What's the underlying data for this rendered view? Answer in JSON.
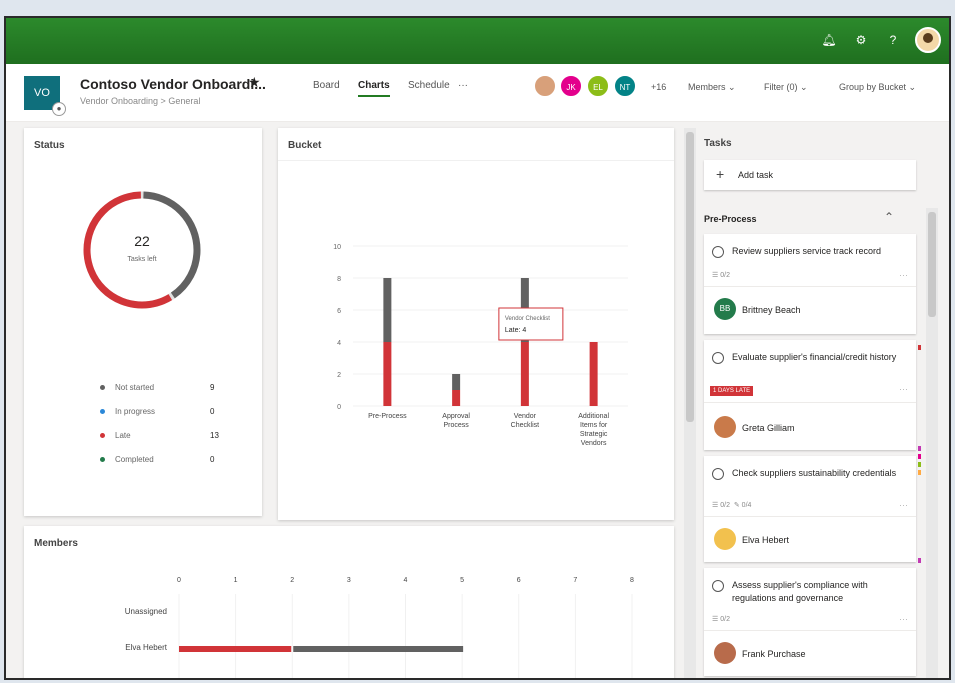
{
  "header": {
    "plan_initials": "VO",
    "plan_title": "Contoso Vendor Onboardi...",
    "plan_subtitle": "Vendor Onboarding > General",
    "tabs": [
      {
        "label": "Board",
        "active": false
      },
      {
        "label": "Charts",
        "active": true
      },
      {
        "label": "Schedule",
        "active": false
      }
    ],
    "tabs_more": "···",
    "member_avatars": [
      {
        "initials": "",
        "color": "#d8a07a"
      },
      {
        "initials": "JK",
        "color": "#e3008c"
      },
      {
        "initials": "EL",
        "color": "#8cbd18"
      },
      {
        "initials": "NT",
        "color": "#038387"
      }
    ],
    "extra_members": "+16",
    "controls": [
      "Members",
      "Filter (0)",
      "Group by Bucket"
    ]
  },
  "status": {
    "title": "Status",
    "count": "22",
    "count_label": "Tasks left",
    "legend": [
      {
        "label": "Not started",
        "count": "9",
        "color": "#616161"
      },
      {
        "label": "In progress",
        "count": "0",
        "color": "#2b88d8"
      },
      {
        "label": "Late",
        "count": "13",
        "color": "#d13438"
      },
      {
        "label": "Completed",
        "count": "0",
        "color": "#237b4b"
      }
    ],
    "donut": {
      "not_started": 9,
      "in_progress": 0,
      "late": 13,
      "completed": 0
    }
  },
  "chart_data": {
    "type": "bar",
    "title": "Bucket",
    "categories": [
      "Pre-Process",
      "Approval Process",
      "Vendor Checklist",
      "Additional Items for Strategic Vendors"
    ],
    "series": [
      {
        "name": "Late",
        "values": [
          4,
          1,
          4,
          4
        ],
        "color": "#d13438"
      },
      {
        "name": "Not started",
        "values": [
          4,
          1,
          4,
          0
        ],
        "color": "#616161"
      }
    ],
    "ylim": [
      0,
      10
    ],
    "yticks": [
      "0",
      "2",
      "4",
      "6",
      "8",
      "10"
    ],
    "grid": true,
    "tooltip": {
      "title": "Vendor Checklist",
      "label": "Late:",
      "value": "4"
    }
  },
  "members": {
    "title": "Members",
    "x_ticks": [
      "0",
      "1",
      "2",
      "3",
      "4",
      "5",
      "6",
      "7",
      "8"
    ],
    "rows": [
      {
        "name": "Unassigned",
        "late": 0,
        "not_started": 0
      },
      {
        "name": "Elva Hebert",
        "late": 2,
        "not_started": 3
      }
    ]
  },
  "tasks_pane": {
    "title": "Tasks",
    "add_task": "Add task",
    "bucket": "Pre-Process",
    "items": [
      {
        "title": "Review suppliers service track record",
        "meta": "0/2",
        "due": "",
        "assignee": "Brittney Beach",
        "initials": "BB",
        "avatar_color": "#237b4b"
      },
      {
        "title": "Evaluate supplier's financial/credit history",
        "meta": "",
        "due": "1 DAYS LATE",
        "assignee": "Greta Gilliam",
        "initials": "",
        "avatar_color": "#c97a4a"
      },
      {
        "title": "Check suppliers sustainability credentials",
        "meta": "0/2",
        "due": "0/4",
        "assignee": "Elva Hebert",
        "initials": "",
        "avatar_color": "#f2c14e"
      },
      {
        "title": "Assess supplier's compliance with regulations and governance",
        "meta": "0/2",
        "due": "",
        "assignee": "Frank Purchase",
        "initials": "",
        "avatar_color": "#b86b4b"
      }
    ]
  },
  "icons": {
    "bell": "bell-icon",
    "gear": "gear-icon",
    "help": "help-icon",
    "star": "star-icon",
    "add": "plus-icon",
    "collapse": "chevron-up-icon"
  }
}
